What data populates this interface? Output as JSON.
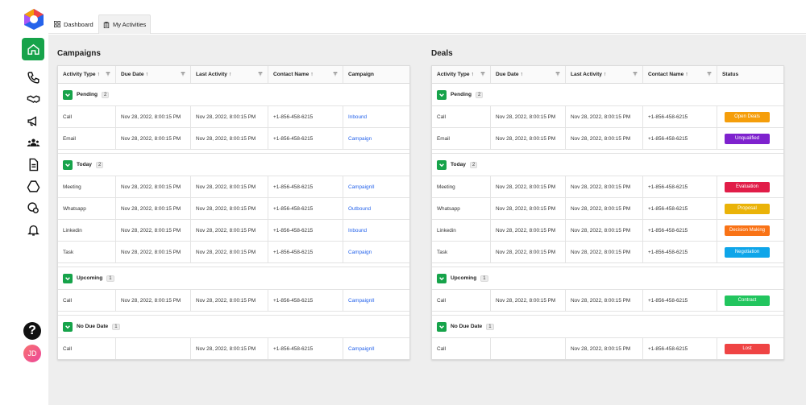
{
  "tabs": {
    "dashboard": "Dashboard",
    "activities": "My Activities"
  },
  "avatar": "JD",
  "help": "?",
  "campaigns": {
    "title": "Campaigns",
    "columns": [
      "Activity Type",
      "Due Date",
      "Last Activity",
      "Contact Name",
      "Campaign"
    ],
    "groups": [
      {
        "label": "Pending",
        "count": "2",
        "rows": [
          [
            "Call",
            "Nov 28, 2022, 8:00:15 PM",
            "Nov 28, 2022, 8:00:15 PM",
            "+1-856-458-6215",
            "Inbound"
          ],
          [
            "Email",
            "Nov 28, 2022, 8:00:15 PM",
            "Nov 28, 2022, 8:00:15 PM",
            "+1-856-458-6215",
            "Campaign"
          ]
        ]
      },
      {
        "label": "Today",
        "count": "2",
        "rows": [
          [
            "Meeting",
            "Nov 28, 2022, 8:00:15 PM",
            "Nov 28, 2022, 8:00:15 PM",
            "+1-856-458-6215",
            "CampaignII"
          ],
          [
            "Whatsapp",
            "Nov 28, 2022, 8:00:15 PM",
            "Nov 28, 2022, 8:00:15 PM",
            "+1-856-458-6215",
            "Outbound"
          ],
          [
            "Linkedin",
            "Nov 28, 2022, 8:00:15 PM",
            "Nov 28, 2022, 8:00:15 PM",
            "+1-856-458-6215",
            "Inbound"
          ],
          [
            "Task",
            "Nov 28, 2022, 8:00:15 PM",
            "Nov 28, 2022, 8:00:15 PM",
            "+1-856-458-6215",
            "Campaign"
          ]
        ]
      },
      {
        "label": "Upcoming",
        "count": "1",
        "rows": [
          [
            "Call",
            "Nov 28, 2022, 8:00:15 PM",
            "Nov 28, 2022, 8:00:15 PM",
            "+1-856-458-6215",
            "CampaignII"
          ]
        ]
      },
      {
        "label": "No Due Date",
        "count": "1",
        "rows": [
          [
            "Call",
            "",
            "Nov 28, 2022, 8:00:15 PM",
            "+1-856-458-6215",
            "CampaignII"
          ]
        ]
      }
    ]
  },
  "deals": {
    "title": "Deals",
    "columns": [
      "Activity Type",
      "Due Date",
      "Last Activity",
      "Contact Name",
      "Status"
    ],
    "groups": [
      {
        "label": "Pending",
        "count": "2",
        "rows": [
          [
            "Call",
            "Nov 28, 2022, 8:00:15 PM",
            "Nov 28, 2022, 8:00:15 PM",
            "+1-856-458-6215",
            "Open Deals",
            "#f59e0b"
          ],
          [
            "Email",
            "Nov 28, 2022, 8:00:15 PM",
            "Nov 28, 2022, 8:00:15 PM",
            "+1-856-458-6215",
            "Unqualified",
            "#7e22ce"
          ]
        ]
      },
      {
        "label": "Today",
        "count": "2",
        "rows": [
          [
            "Meeting",
            "Nov 28, 2022, 8:00:15 PM",
            "Nov 28, 2022, 8:00:15 PM",
            "+1-856-458-6215",
            "Evaluation",
            "#e11d48"
          ],
          [
            "Whatsapp",
            "Nov 28, 2022, 8:00:15 PM",
            "Nov 28, 2022, 8:00:15 PM",
            "+1-856-458-6215",
            "Proposal",
            "#eab308"
          ],
          [
            "Linkedin",
            "Nov 28, 2022, 8:00:15 PM",
            "Nov 28, 2022, 8:00:15 PM",
            "+1-856-458-6215",
            "Decision Making",
            "#f97316"
          ],
          [
            "Task",
            "Nov 28, 2022, 8:00:15 PM",
            "Nov 28, 2022, 8:00:15 PM",
            "+1-856-458-6215",
            "Negotiation",
            "#0ea5e9"
          ]
        ]
      },
      {
        "label": "Upcoming",
        "count": "1",
        "rows": [
          [
            "Call",
            "Nov 28, 2022, 8:00:15 PM",
            "Nov 28, 2022, 8:00:15 PM",
            "+1-856-458-6215",
            "Contract",
            "#22c55e"
          ]
        ]
      },
      {
        "label": "No Due Date",
        "count": "1",
        "rows": [
          [
            "Call",
            "",
            "Nov 28, 2022, 8:00:15 PM",
            "+1-856-458-6215",
            "Lost",
            "#ef4444"
          ]
        ]
      }
    ]
  }
}
